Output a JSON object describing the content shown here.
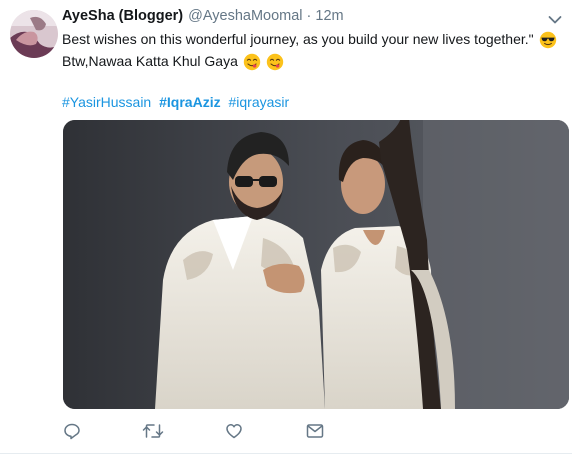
{
  "tweet": {
    "author_name": "AyeSha (Blogger)",
    "handle": "@AyeshaMoomal",
    "separator": "·",
    "time": "12m",
    "line1": "Best wishes on this wonderful journey, as you build your new lives together.\"",
    "line2": "Btw,Nawaa Katta Khul Gaya",
    "hashtags": [
      {
        "text": "#YasirHussain",
        "bold": false
      },
      {
        "text": "#IqraAziz",
        "bold": true
      },
      {
        "text": "#iqrayasir",
        "bold": false
      }
    ],
    "emojis": [
      "sunglasses-emoji",
      "yum-emoji",
      "yum-emoji"
    ]
  },
  "actions": [
    "reply-icon",
    "retweet-icon",
    "like-icon",
    "direct-message-icon"
  ],
  "colors": {
    "link": "#1b95e0",
    "muted": "#657786",
    "text": "#14171a",
    "icon": "#657786"
  }
}
